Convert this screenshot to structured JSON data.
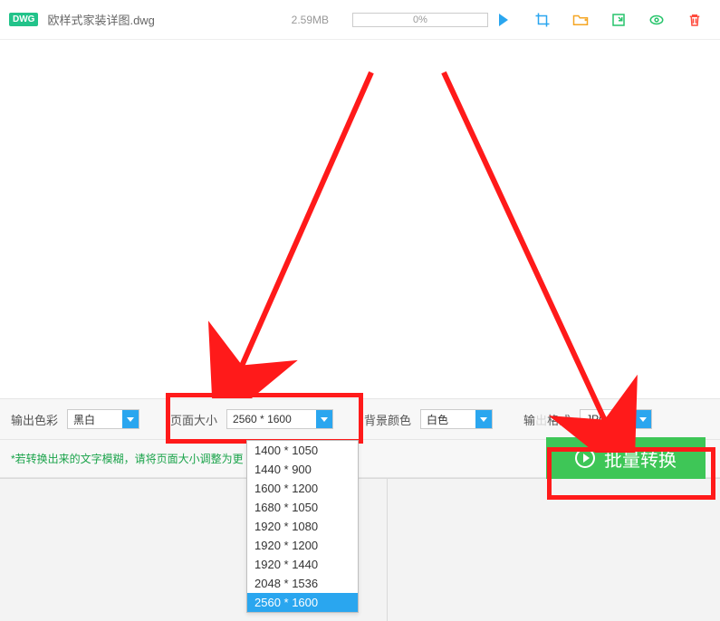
{
  "file": {
    "badge": "DWG",
    "name": "欧样式家装详图.dwg",
    "size": "2.59MB",
    "progress": "0%"
  },
  "settings": {
    "color_label": "输出色彩",
    "color_value": "黑白",
    "page_label": "页面大小",
    "page_value": "2560 * 1600",
    "bg_label": "背景颜色",
    "bg_value": "白色",
    "fmt_label_prefix": "输",
    "fmt_label_suffix": "格式",
    "fmt_value": "JPG"
  },
  "hint": "*若转换出来的文字模糊，请将页面大小调整为更",
  "convert_label": "批量转换",
  "page_options": [
    "1400 * 1050",
    "1440 * 900",
    "1600 * 1200",
    "1680 * 1050",
    "1920 * 1080",
    "1920 * 1200",
    "1920 * 1440",
    "2048 * 1536",
    "2560 * 1600"
  ],
  "page_selected_index": 8
}
